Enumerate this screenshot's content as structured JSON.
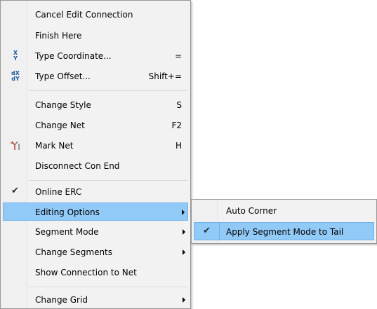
{
  "main_menu": {
    "items": [
      {
        "label": "Cancel Edit Connection"
      },
      {
        "label": "Finish Here"
      },
      {
        "label": "Type Coordinate...",
        "shortcut": "=",
        "icon": "xy-coordinate-icon",
        "icon_text_top": "X",
        "icon_text_bottom": "Y"
      },
      {
        "label": "Type Offset...",
        "shortcut": "Shift+=",
        "icon": "dxdy-offset-icon",
        "icon_text_top": "dX",
        "icon_text_bottom": "dY"
      },
      {
        "label": "Change Style",
        "shortcut": "S"
      },
      {
        "label": "Change Net",
        "shortcut": "F2"
      },
      {
        "label": "Mark Net",
        "shortcut": "H",
        "icon": "mark-net-icon"
      },
      {
        "label": "Disconnect Con End"
      },
      {
        "label": "Online ERC",
        "checked": true,
        "icon": "checkmark-icon"
      },
      {
        "label": "Editing Options",
        "highlighted": true,
        "submenu": true
      },
      {
        "label": "Segment Mode",
        "submenu": true
      },
      {
        "label": "Change Segments",
        "submenu": true
      },
      {
        "label": "Show Connection to Net"
      },
      {
        "label": "Change Grid",
        "submenu": true
      }
    ]
  },
  "sub_menu": {
    "items": [
      {
        "label": "Auto Corner"
      },
      {
        "label": "Apply Segment Mode to Tail",
        "checked": true,
        "highlighted": true,
        "icon": "checkmark-icon"
      }
    ]
  },
  "glyphs": {
    "check": "✔"
  },
  "colors": {
    "highlight": "#91c9f7",
    "highlight_border": "#6fb3ea",
    "menu_background": "#f2f2f2",
    "icon_blue": "#1f5aa0",
    "mark_net_red": "#c0392b"
  }
}
